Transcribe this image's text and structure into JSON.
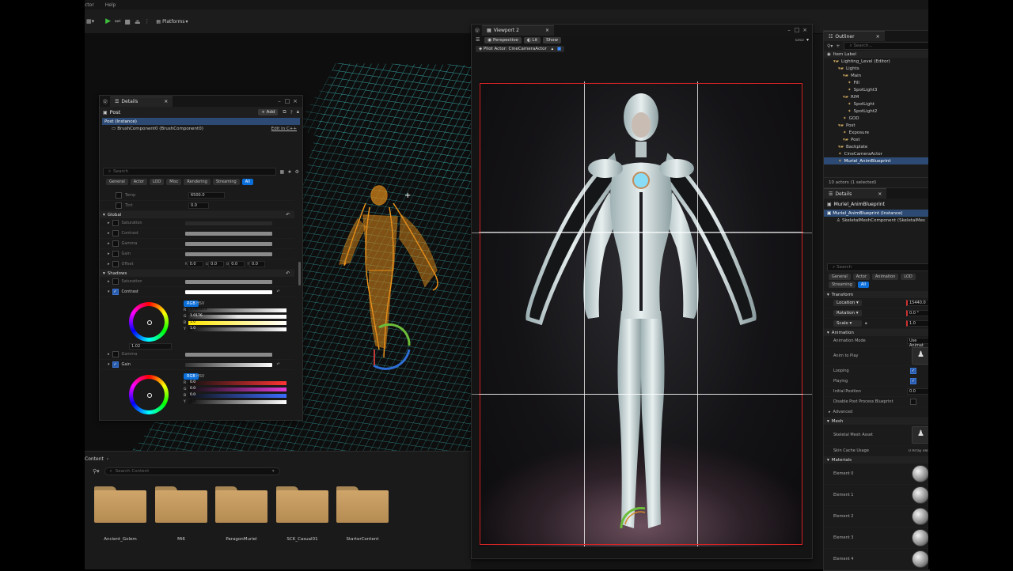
{
  "menubar": {
    "items": [
      "ctor",
      "Help"
    ]
  },
  "toolbar": {
    "platforms_label": "Platforms"
  },
  "details_window": {
    "tab_title": "Details",
    "actor_name": "Post",
    "add_label": "Add",
    "tree": [
      {
        "label": "Post (Instance)"
      },
      {
        "label": "BrushComponent0 (BrushComponent0)",
        "action": "Edit in C++"
      }
    ],
    "search_placeholder": "Search",
    "filters": [
      "General",
      "Actor",
      "LOD",
      "Misc",
      "Rendering",
      "Streaming",
      "All"
    ],
    "top_props": [
      {
        "label": "Temp",
        "value": "6500.0"
      },
      {
        "label": "Tint",
        "value": "0.0"
      }
    ],
    "global_section": "Global",
    "global_props": [
      "Saturation",
      "Contrast",
      "Gamma",
      "Gain",
      "Offset"
    ],
    "offset_fields": {
      "r": "0.0",
      "g": "0.0",
      "b": "0.0",
      "y": "0.0"
    },
    "shadows_section": "Shadows",
    "shadow_props": [
      "Saturation",
      "Contrast"
    ],
    "contrast_picker": {
      "modes": [
        "RGB",
        "HSV"
      ],
      "value": "1.02",
      "channels": [
        {
          "key": "R",
          "value": "1.085403"
        },
        {
          "key": "G",
          "value": "1.0176"
        },
        {
          "key": "B",
          "value": "1.0"
        },
        {
          "key": "Y",
          "value": "1.0"
        }
      ]
    },
    "gamma_label": "Gamma",
    "gain_label": "Gain",
    "gain_picker": {
      "modes": [
        "RGB",
        "HSV"
      ],
      "channels": [
        {
          "key": "R",
          "value": "0.0"
        },
        {
          "key": "G",
          "value": "0.0"
        },
        {
          "key": "B",
          "value": "0.0"
        },
        {
          "key": "Y",
          "value": "1.0"
        }
      ]
    }
  },
  "viewport2": {
    "tab_title": "Viewport 2",
    "buttons": [
      "Perspective",
      "Lit",
      "Show"
    ],
    "pilot_label": "Pilot Actor: CineCameraActor"
  },
  "content_browser": {
    "breadcrumb": "Content",
    "search_placeholder": "Search Content",
    "folders": [
      "Ancient_Golem",
      "Mi6",
      "ParagonMuriel",
      "SCK_Casual01",
      "StarterContent"
    ]
  },
  "outliner": {
    "tab_title": "Outliner",
    "search_placeholder": "Search...",
    "column_label": "Item Label",
    "items": [
      {
        "label": "Lighting_Level (Editor)",
        "indent": 1
      },
      {
        "label": "Lights",
        "indent": 2
      },
      {
        "label": "Main",
        "indent": 3
      },
      {
        "label": "Fill",
        "indent": 4
      },
      {
        "label": "SpotLight3",
        "indent": 4
      },
      {
        "label": "RIM",
        "indent": 3
      },
      {
        "label": "SpotLight",
        "indent": 4
      },
      {
        "label": "SpotLight2",
        "indent": 4
      },
      {
        "label": "GOD",
        "indent": 3
      },
      {
        "label": "Post",
        "indent": 2
      },
      {
        "label": "Exposure",
        "indent": 3
      },
      {
        "label": "Post",
        "indent": 3
      },
      {
        "label": "Backplate",
        "indent": 2
      },
      {
        "label": "CineCameraActor",
        "indent": 2
      },
      {
        "label": "Muriel_AnimBlueprint",
        "indent": 2,
        "selected": true
      }
    ],
    "status": "10 actors (1 selected)"
  },
  "details_right": {
    "tab_title": "Details",
    "actor_name": "Muriel_AnimBlueprint",
    "tree": [
      {
        "label": "Muriel_AnimBlueprint (Instance)"
      },
      {
        "label": "SkeletalMeshComponent (SkeletalMes"
      }
    ],
    "search_placeholder": "Search",
    "filters_row1": [
      "General",
      "Actor",
      "Animation",
      "LOD"
    ],
    "filters_row2": [
      "Streaming",
      "All"
    ],
    "transform_section": "Transform",
    "transform": [
      {
        "label": "Location",
        "value": "15440.0"
      },
      {
        "label": "Rotation",
        "value": "0.0 °"
      },
      {
        "label": "Scale",
        "value": "1.0"
      }
    ],
    "animation_section": "Animation",
    "anim_mode_label": "Animation Mode",
    "anim_mode_value": "Use Animat",
    "anim_to_play": "Anim to Play",
    "looping": "Looping",
    "playing": "Playing",
    "initial_position": "Initial Position",
    "initial_position_value": "0.0",
    "disable_pp": "Disable Post Process Blueprint",
    "advanced": "Advanced",
    "mesh_section": "Mesh",
    "skeletal_mesh_asset": "Skeletal Mesh Asset",
    "skin_cache_label": "Skin Cache Usage",
    "skin_cache_value": "0 Array elem",
    "materials_section": "Materials",
    "elements": [
      "Element 0",
      "Element 1",
      "Element 2",
      "Element 3",
      "Element 4"
    ]
  }
}
